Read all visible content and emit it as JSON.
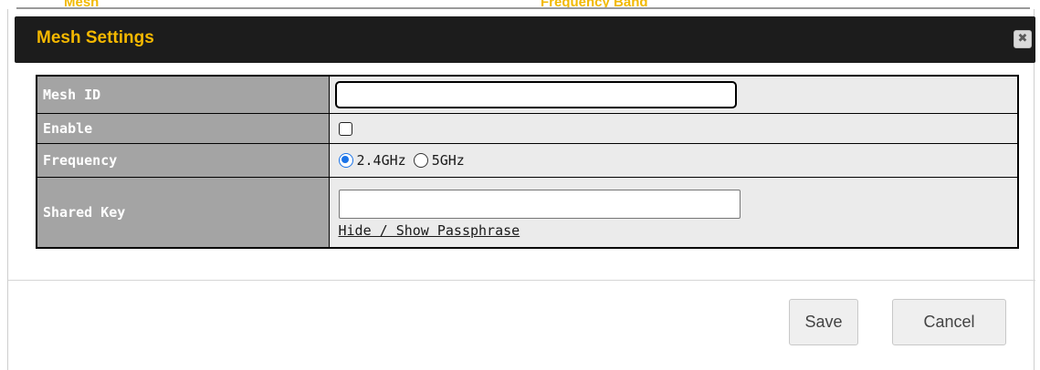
{
  "dialog": {
    "title": "Mesh Settings",
    "close_glyph": "✖"
  },
  "background": {
    "fragment_1": "Mesh",
    "fragment_2": "Frequency Band"
  },
  "form": {
    "mesh_id": {
      "label": "Mesh ID",
      "value": ""
    },
    "enable": {
      "label": "Enable",
      "checked": false
    },
    "frequency": {
      "label": "Frequency",
      "options": [
        "2.4GHz",
        "5GHz"
      ],
      "selected": "2.4GHz"
    },
    "shared_key": {
      "label": "Shared Key",
      "value": "",
      "toggle_link": "Hide / Show Passphrase"
    }
  },
  "actions": {
    "save_label": "Save",
    "cancel_label": "Cancel"
  },
  "colors": {
    "title_text": "#f5b800",
    "title_bar": "#1c1c1c",
    "label_cell": "#a4a4a4",
    "value_cell": "#ebebeb",
    "radio_accent": "#1a73e8"
  }
}
